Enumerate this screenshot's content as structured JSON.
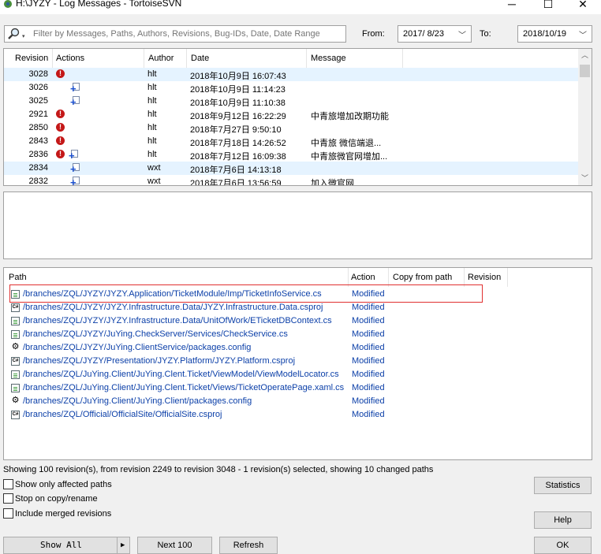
{
  "window": {
    "title": "H:\\JYZY - Log Messages - TortoiseSVN",
    "minimize": "─",
    "maximize": "☐",
    "close": "✕"
  },
  "filter": {
    "placeholder": "Filter by Messages, Paths, Authors, Revisions, Bug-IDs, Date, Date Range",
    "search_icon": "magnifier-icon",
    "from_label": "From:",
    "from_value": "2017/ 8/23",
    "to_label": "To:",
    "to_value": "2018/10/19"
  },
  "log": {
    "columns": [
      "Revision",
      "Actions",
      "Author",
      "Date",
      "Message"
    ],
    "rows": [
      {
        "revision": "3028",
        "actions": [
          "stop"
        ],
        "author": "hlt",
        "date": "2018年10月9日 16:07:43",
        "message": "",
        "selected": true
      },
      {
        "revision": "3026",
        "actions": [
          "add"
        ],
        "author": "hlt",
        "date": "2018年10月9日 11:14:23",
        "message": "",
        "selected": false
      },
      {
        "revision": "3025",
        "actions": [
          "add"
        ],
        "author": "hlt",
        "date": "2018年10月9日 11:10:38",
        "message": "",
        "selected": false
      },
      {
        "revision": "2921",
        "actions": [
          "stop"
        ],
        "author": "hlt",
        "date": "2018年9月12日 16:22:29",
        "message": "中青旅增加改期功能",
        "selected": false
      },
      {
        "revision": "2850",
        "actions": [
          "stop"
        ],
        "author": "hlt",
        "date": "2018年7月27日 9:50:10",
        "message": "",
        "selected": false
      },
      {
        "revision": "2843",
        "actions": [
          "stop"
        ],
        "author": "hlt",
        "date": "2018年7月18日 14:26:52",
        "message": "中青旅 微信端退...",
        "selected": false
      },
      {
        "revision": "2836",
        "actions": [
          "stop",
          "add"
        ],
        "author": "hlt",
        "date": "2018年7月12日 16:09:38",
        "message": "中青旅微官网增加...",
        "selected": false
      },
      {
        "revision": "2834",
        "actions": [
          "add"
        ],
        "author": "wxt",
        "date": "2018年7月6日 14:13:18",
        "message": "",
        "selected": true
      },
      {
        "revision": "2832",
        "actions": [
          "add"
        ],
        "author": "wxt",
        "date": "2018年7月6日 13:56:59",
        "message": "加入微官网",
        "selected": false
      }
    ]
  },
  "paths": {
    "columns": [
      "Path",
      "Action",
      "Copy from path",
      "Revision"
    ],
    "rows": [
      {
        "icon": "cs",
        "path": "/branches/ZQL/JYZY/JYZY.Application/TicketModule/Imp/TicketInfoService.cs",
        "action": "Modified"
      },
      {
        "icon": "proj",
        "path": "/branches/ZQL/JYZY/JYZY.Infrastructure.Data/JYZY.Infrastructure.Data.csproj",
        "action": "Modified"
      },
      {
        "icon": "cs",
        "path": "/branches/ZQL/JYZY/JYZY.Infrastructure.Data/UnitOfWork/ETicketDBContext.cs",
        "action": "Modified"
      },
      {
        "icon": "cs",
        "path": "/branches/ZQL/JYZY/JuYing.CheckServer/Services/CheckService.cs",
        "action": "Modified"
      },
      {
        "icon": "cfg",
        "path": "/branches/ZQL/JYZY/JuYing.ClientService/packages.config",
        "action": "Modified"
      },
      {
        "icon": "proj",
        "path": "/branches/ZQL/JYZY/Presentation/JYZY.Platform/JYZY.Platform.csproj",
        "action": "Modified"
      },
      {
        "icon": "cs",
        "path": "/branches/ZQL/JuYing.Client/JuYing.Clent.Ticket/ViewModel/ViewModelLocator.cs",
        "action": "Modified"
      },
      {
        "icon": "cs",
        "path": "/branches/ZQL/JuYing.Client/JuYing.Clent.Ticket/Views/TicketOperatePage.xaml.cs",
        "action": "Modified"
      },
      {
        "icon": "cfg",
        "path": "/branches/ZQL/JuYing.Client/JuYing.Client/packages.config",
        "action": "Modified"
      },
      {
        "icon": "proj",
        "path": "/branches/ZQL/Official/OfficialSite/OfficialSite.csproj",
        "action": "Modified"
      }
    ]
  },
  "status": {
    "text": "Showing 100 revision(s), from revision 2249 to revision 3048 - 1 revision(s) selected, showing 10 changed paths"
  },
  "options": {
    "show_affected": "Show only affected paths",
    "stop_on_copy": "Stop on copy/rename",
    "include_merged": "Include merged revisions"
  },
  "buttons": {
    "show_all": "Show All",
    "show_all_arrow": "▶",
    "next_100": "Next 100",
    "refresh": "Refresh",
    "statistics": "Statistics",
    "help": "Help",
    "ok": "OK"
  },
  "colors": {
    "selection": "#e5f3ff",
    "highlight_border": "#e03030",
    "path_text": "#0b3fa8"
  }
}
